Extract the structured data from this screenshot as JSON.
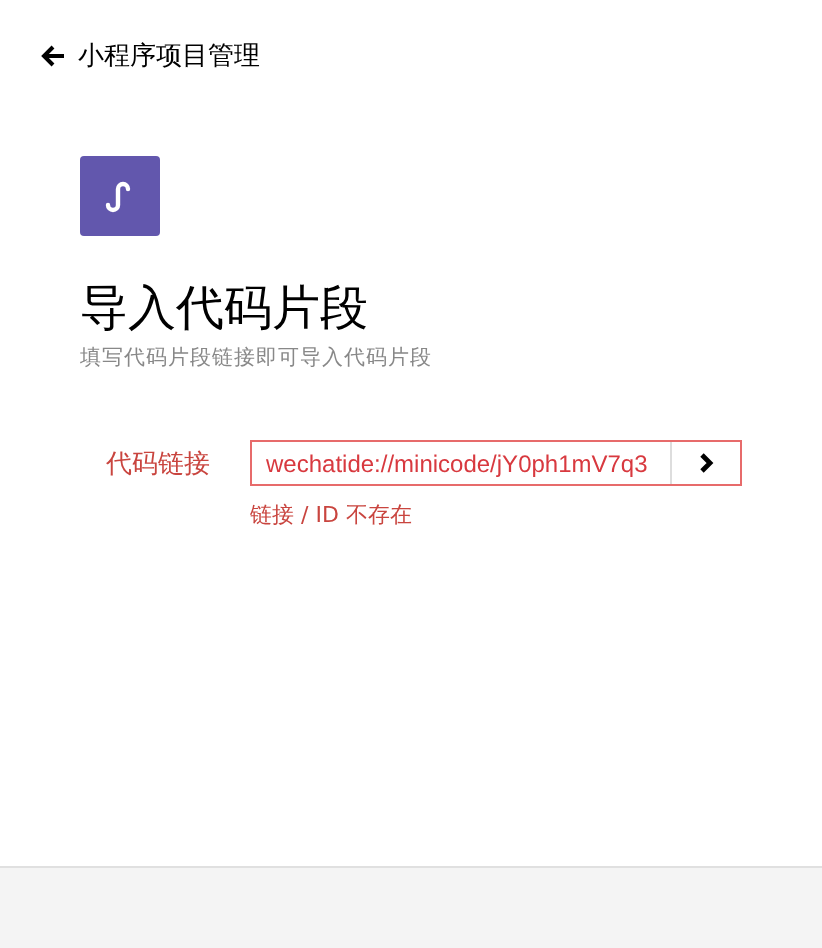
{
  "back_link": {
    "label": "小程序项目管理"
  },
  "title": "导入代码片段",
  "subtitle": "填写代码片段链接即可导入代码片段",
  "field": {
    "label": "代码链接",
    "value": "wechatide://minicode/jY0ph1mV7q3",
    "invalid": true,
    "error": "链接 / ID 不存在"
  }
}
